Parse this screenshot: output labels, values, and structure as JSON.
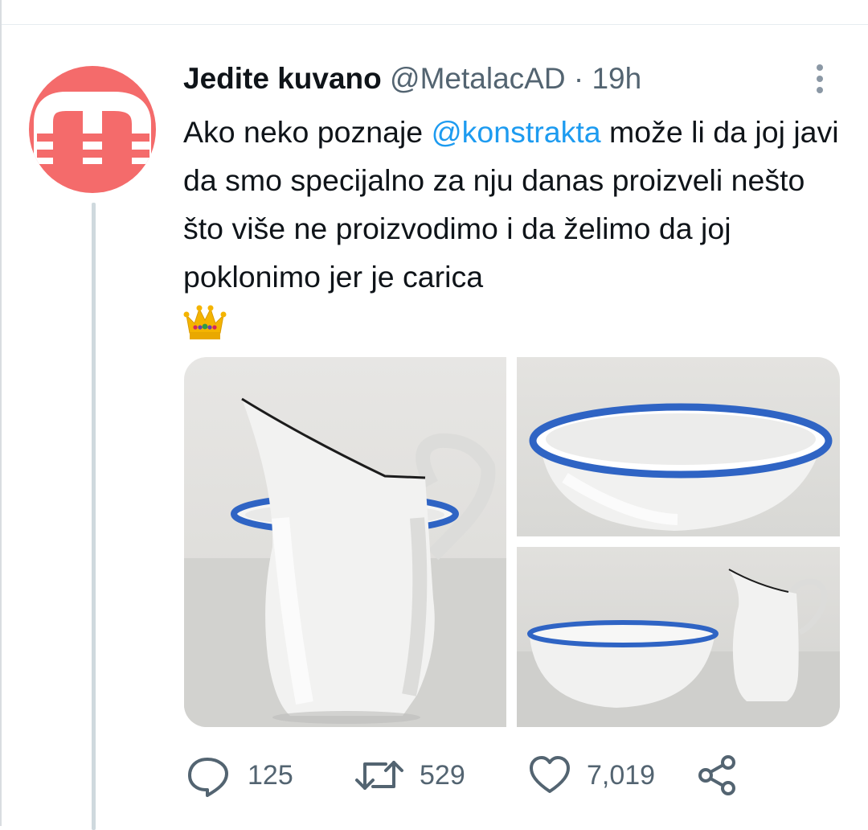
{
  "tweet": {
    "author_name": "Jedite kuvano",
    "author_handle": "@MetalacAD",
    "separator": "·",
    "time": "19h",
    "text_before_mention": "Ako neko poznaje ",
    "mention": "@konstrakta",
    "text_after_mention": " može li da joj javi da smo specijalno za nju danas proizveli nešto što više ne proizvodimo i da želimo da joj poklonimo jer je carica",
    "emoji": "crown-emoji",
    "avatar_icon": "metalac-m-logo",
    "avatar_color": "#f46b6b",
    "mention_color": "#1d9bf0"
  },
  "media": {
    "images": [
      {
        "subject": "white-enamel-pitcher-and-bowl-photo"
      },
      {
        "subject": "white-enamel-bowl-blue-rim-photo"
      },
      {
        "subject": "enamel-bowl-and-pitcher-set-photo"
      }
    ],
    "rim_color": "#2f64c4"
  },
  "actions": {
    "replies": "125",
    "retweets": "529",
    "likes": "7,019",
    "icons": [
      "reply-icon",
      "retweet-icon",
      "like-icon",
      "share-icon"
    ]
  }
}
